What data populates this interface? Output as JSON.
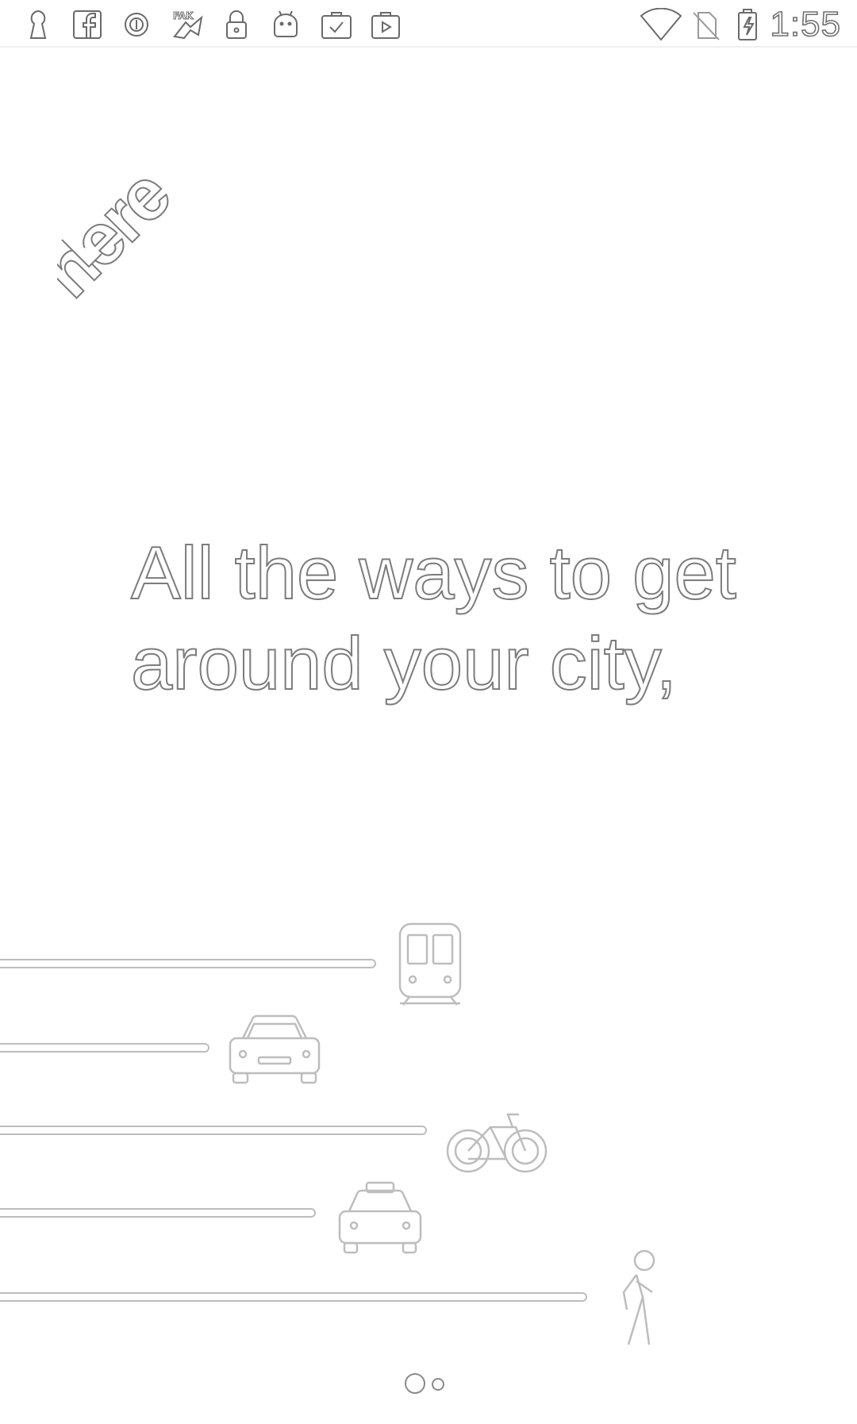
{
  "status_bar": {
    "time": "1:55",
    "notification_icons": [
      "keyhole-icon",
      "facebook-icon",
      "circle-info-icon",
      "news-badge-icon",
      "lock-icon",
      "android-icon",
      "clipboard-check-icon",
      "play-store-icon"
    ],
    "system_icons": [
      "wifi-icon",
      "no-sim-icon",
      "battery-charging-icon"
    ]
  },
  "logo": {
    "text": "here"
  },
  "headline": {
    "line1": "All the ways to get",
    "line2": "around your city,"
  },
  "transport_modes": [
    {
      "name": "train",
      "icon": "train-icon"
    },
    {
      "name": "car",
      "icon": "car-icon"
    },
    {
      "name": "bicycle",
      "icon": "bicycle-icon"
    },
    {
      "name": "taxi",
      "icon": "taxi-icon"
    },
    {
      "name": "walking",
      "icon": "pedestrian-icon"
    }
  ],
  "pager": {
    "total_pages": 2,
    "current_page": 1
  },
  "colors": {
    "background": "#ffffff",
    "outline": "#8a8a8a",
    "line": "#bdbdbd"
  }
}
